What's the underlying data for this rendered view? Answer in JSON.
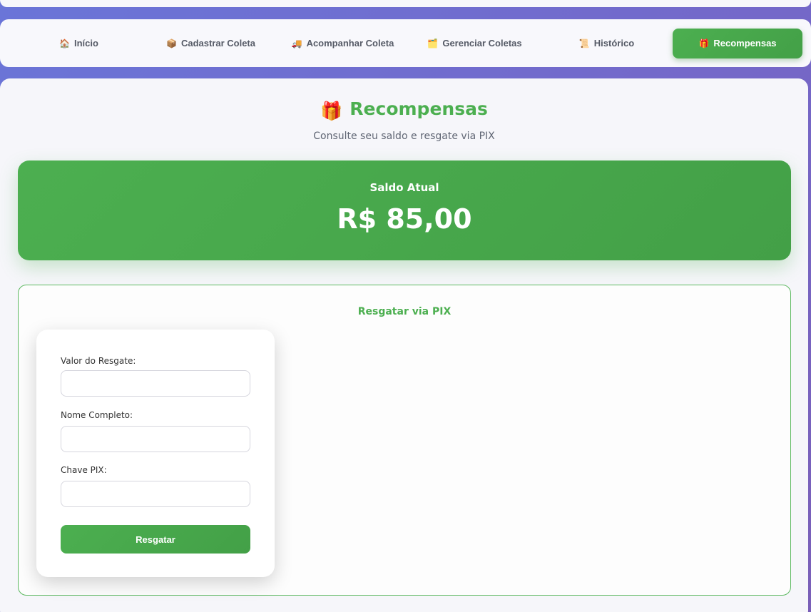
{
  "nav": {
    "items": [
      {
        "icon": "🏠",
        "label": "Início"
      },
      {
        "icon": "📦",
        "label": "Cadastrar Coleta"
      },
      {
        "icon": "🚚",
        "label": "Acompanhar Coleta"
      },
      {
        "icon": "🗂️",
        "label": "Gerenciar Coletas"
      },
      {
        "icon": "📜",
        "label": "Histórico"
      },
      {
        "icon": "🎁",
        "label": "Recompensas"
      }
    ],
    "active_index": 5
  },
  "page": {
    "icon": "🎁",
    "title": "Recompensas",
    "subtitle": "Consulte seu saldo e resgate via PIX"
  },
  "balance": {
    "label": "Saldo Atual",
    "value": "R$ 85,00"
  },
  "redeem": {
    "title": "Resgatar via PIX",
    "amount_label": "Valor do Resgate:",
    "amount_value": "",
    "name_label": "Nome Completo:",
    "name_value": "",
    "pix_label": "Chave PIX:",
    "pix_value": "",
    "submit_label": "Resgatar"
  },
  "colors": {
    "accent_green": "#4caf50",
    "background_gradient_start": "#6a75d8",
    "background_gradient_end": "#7a5fb8"
  }
}
